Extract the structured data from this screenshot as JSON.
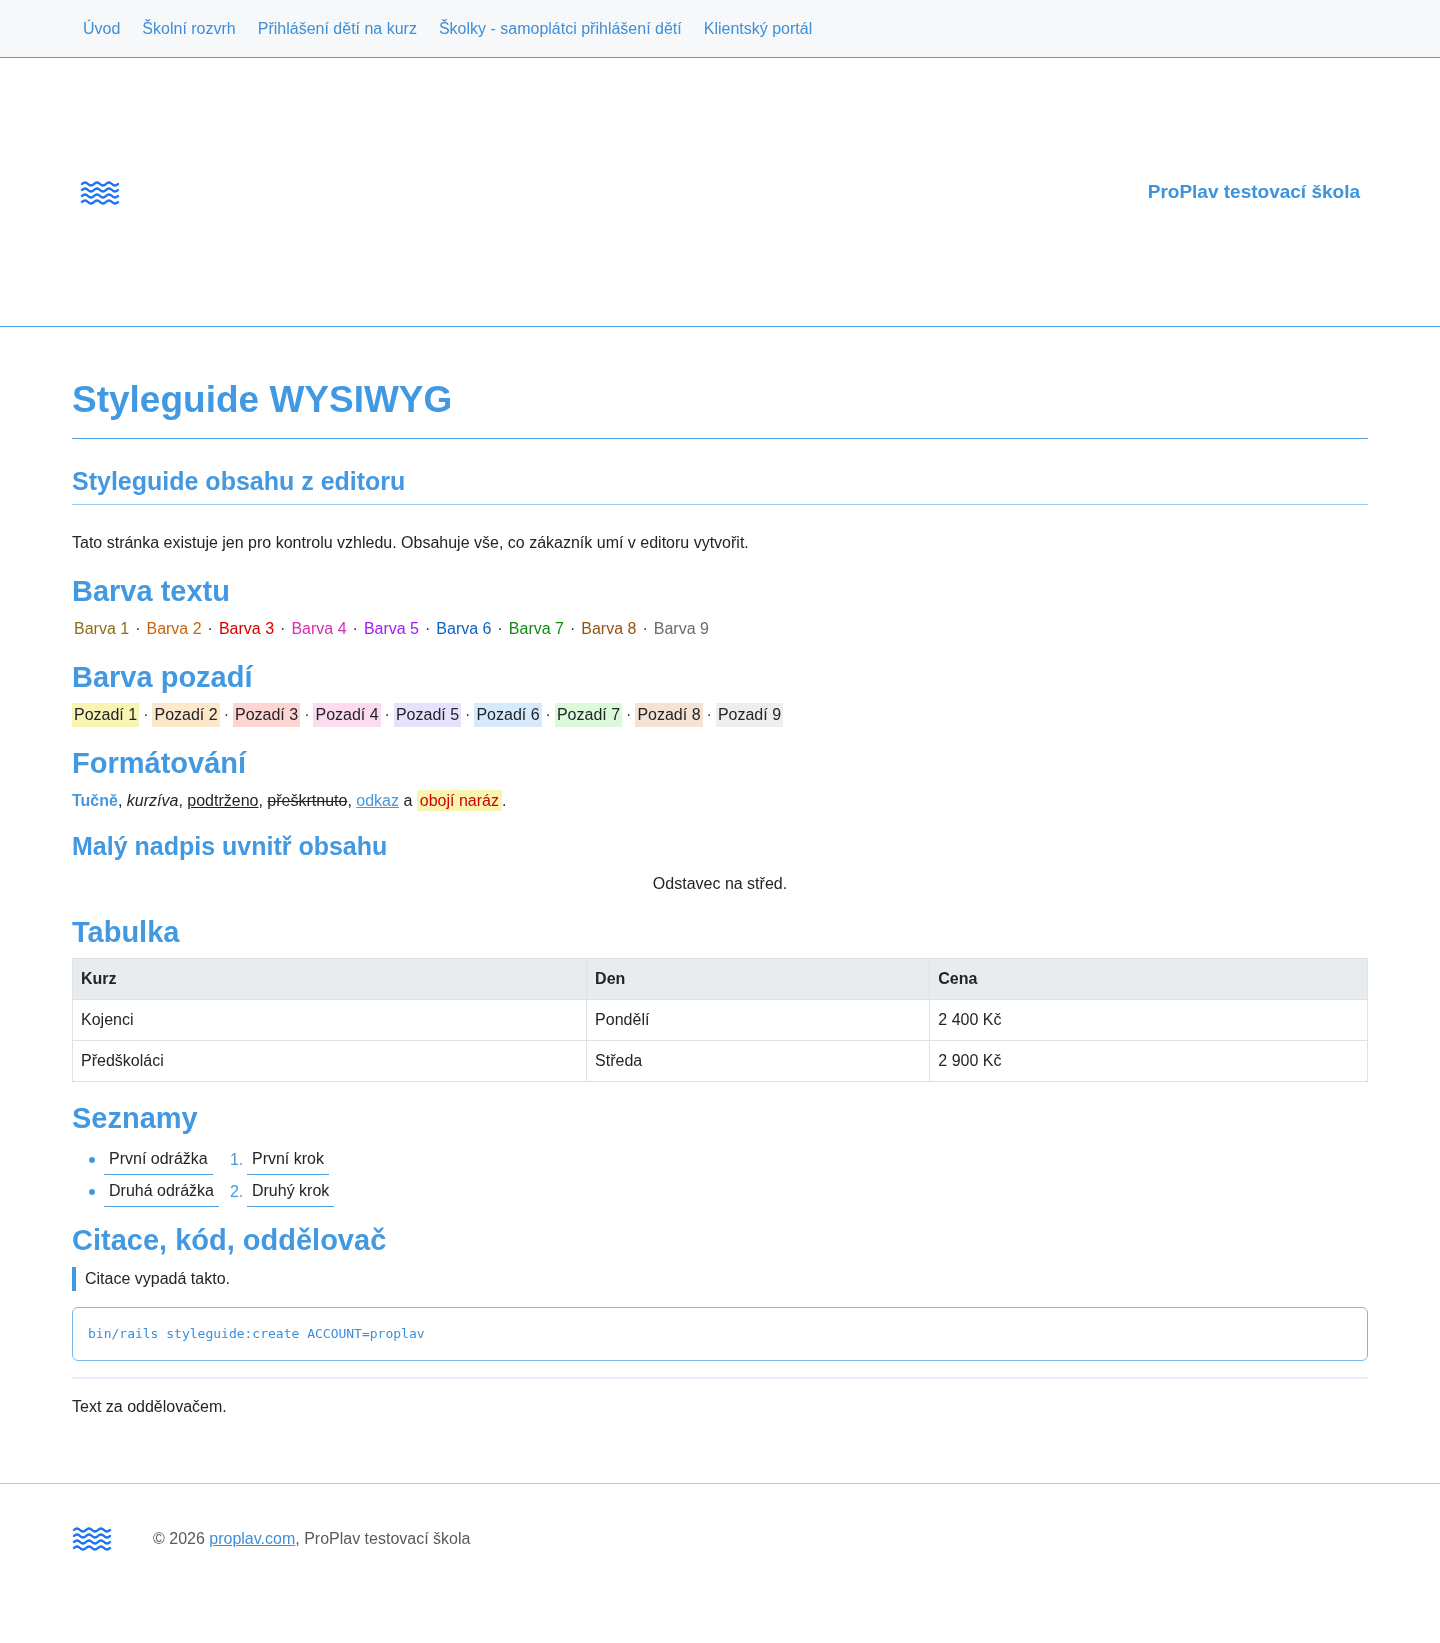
{
  "nav": [
    "Úvod",
    "Školní rozvrh",
    "Přihlášení dětí na kurz",
    "Školky - samoplátci přihlášení dětí",
    "Klientský portál"
  ],
  "header": {
    "school_name": "ProPlav testovací škola"
  },
  "page_title": "Styleguide WYSIWYG",
  "subtitle": "Styleguide obsahu z editoru",
  "intro": "Tato stránka existuje jen pro kontrolu vzhledu. Obsahuje vše, co zákazník umí v editoru vytvořit.",
  "text_colors": {
    "heading": "Barva textu",
    "separator": "·",
    "items": [
      {
        "label": "Barva 1",
        "color": "#8b6d1a"
      },
      {
        "label": "Barva 2",
        "color": "#c7660e"
      },
      {
        "label": "Barva 3",
        "color": "#d40000"
      },
      {
        "label": "Barva 4",
        "color": "#db2bb5"
      },
      {
        "label": "Barva 5",
        "color": "#a21cf0"
      },
      {
        "label": "Barva 6",
        "color": "#0c63c4"
      },
      {
        "label": "Barva 7",
        "color": "#138a13"
      },
      {
        "label": "Barva 8",
        "color": "#935410"
      },
      {
        "label": "Barva 9",
        "color": "#6b6b6b"
      }
    ]
  },
  "background_colors": {
    "heading": "Barva pozadí",
    "separator": "·",
    "items": [
      {
        "label": "Pozadí 1",
        "color": "#f8f5b3"
      },
      {
        "label": "Pozadí 2",
        "color": "#fde8cc"
      },
      {
        "label": "Pozadí 3",
        "color": "#fdd6d3"
      },
      {
        "label": "Pozadí 4",
        "color": "#fcdbf1"
      },
      {
        "label": "Pozadí 5",
        "color": "#e8e1fd"
      },
      {
        "label": "Pozadí 6",
        "color": "#d7eafc"
      },
      {
        "label": "Pozadí 7",
        "color": "#dcf9d9"
      },
      {
        "label": "Pozadí 8",
        "color": "#f5e2d4"
      },
      {
        "label": "Pozadí 9",
        "color": "#eeeeee"
      }
    ]
  },
  "formatting": {
    "heading": "Formátování",
    "segments": [
      {
        "kind": "bold",
        "text": "Tučně"
      },
      {
        "kind": "plain",
        "text": ", "
      },
      {
        "kind": "italic",
        "text": "kurzíva"
      },
      {
        "kind": "plain",
        "text": ", "
      },
      {
        "kind": "underline",
        "text": "podtrženo"
      },
      {
        "kind": "plain",
        "text": ", "
      },
      {
        "kind": "strike",
        "text": "přeškrtnuto"
      },
      {
        "kind": "plain",
        "text": ", "
      },
      {
        "kind": "link",
        "text": "odkaz"
      },
      {
        "kind": "plain",
        "text": " a "
      },
      {
        "kind": "highlight",
        "text": "obojí naráz"
      },
      {
        "kind": "plain",
        "text": "."
      }
    ]
  },
  "small_heading": "Malý nadpis uvnitř obsahu",
  "centered_paragraph": "Odstavec na střed.",
  "table": {
    "heading": "Tabulka",
    "columns": [
      "Kurz",
      "Den",
      "Cena"
    ],
    "rows": [
      [
        "Kojenci",
        "Pondělí",
        "2 400 Kč"
      ],
      [
        "Předškoláci",
        "Středa",
        "2 900 Kč"
      ]
    ]
  },
  "lists": {
    "heading": "Seznamy",
    "bulleted": [
      "První odrážka",
      "Druhá odrážka"
    ],
    "numbered": [
      {
        "marker": "1.",
        "text": "První krok"
      },
      {
        "marker": "2.",
        "text": "Druhý krok"
      }
    ]
  },
  "quote_code": {
    "heading": "Citace, kód, oddělovač",
    "quote": "Citace vypadá takto.",
    "code": "bin/rails styleguide:create ACCOUNT=proplav",
    "after_divider": "Text za oddělovačem."
  },
  "footer": {
    "segments": [
      {
        "kind": "plain",
        "text": "© 2026 "
      },
      {
        "kind": "link",
        "text": "proplav.com"
      },
      {
        "kind": "plain",
        "text": ", ProPlav testovací škola"
      }
    ]
  }
}
